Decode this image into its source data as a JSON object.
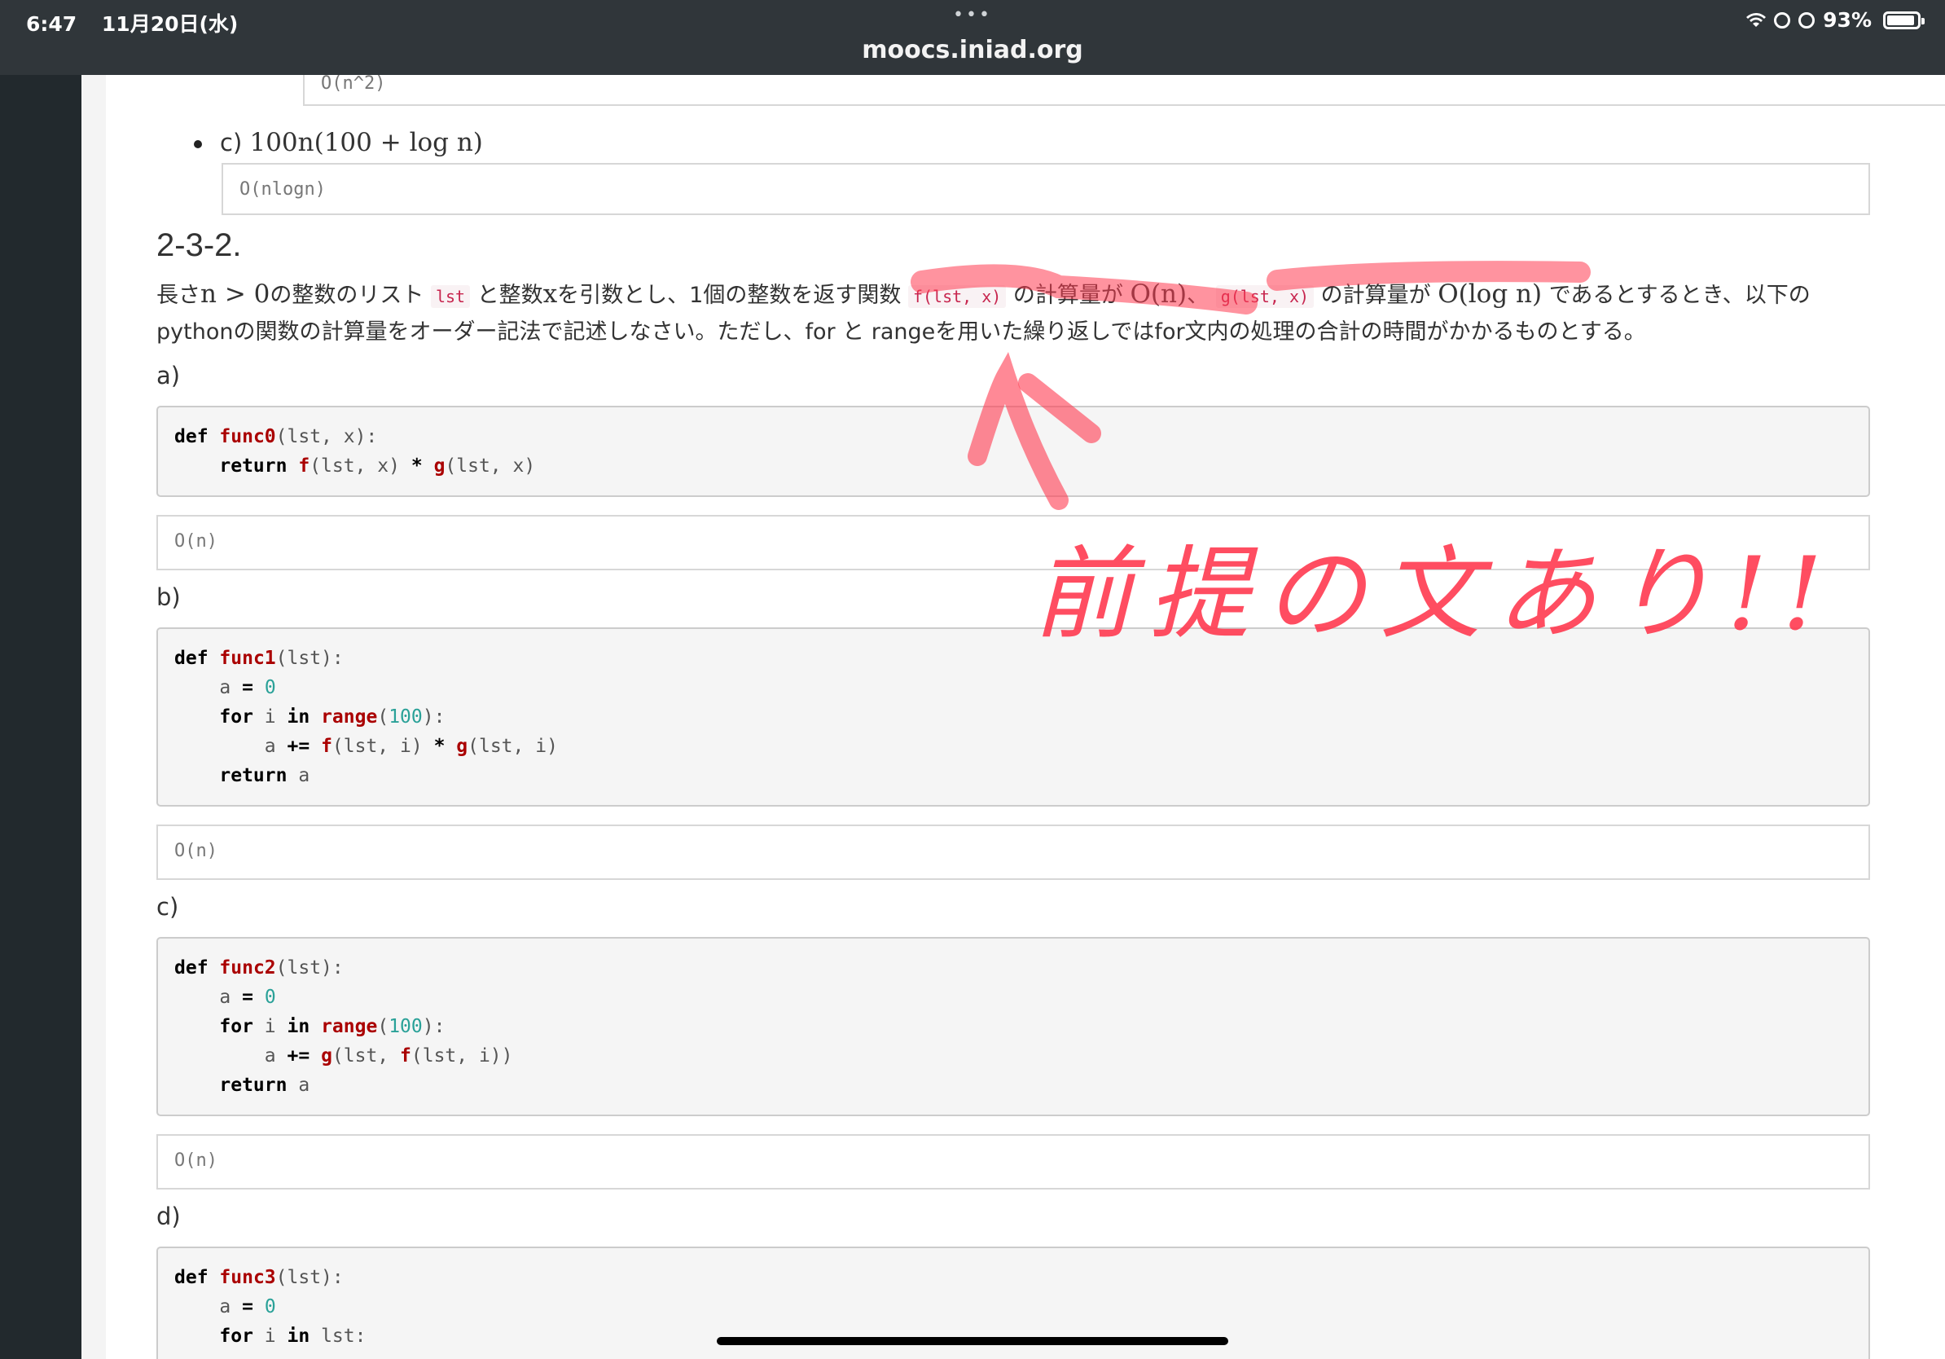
{
  "status_bar": {
    "time": "6:47",
    "date": "11月20日(水)",
    "battery": "93%",
    "battery_level": 0.93,
    "dots": "•••"
  },
  "url_bar": {
    "domain": "moocs.iniad.org"
  },
  "prev_answer": {
    "value": "O(n^2)"
  },
  "item_c": {
    "label": "c)",
    "math": "100n(100 + log n)",
    "answer": "O(nlogn)"
  },
  "section": {
    "title": "2-3-2.",
    "text_1": "長さ",
    "math_1": "n > 0",
    "text_2": "の整数のリスト",
    "code_lst": "lst",
    "text_3": "と整数",
    "math_x": "x",
    "text_4": "を引数とし、1個の整数を返す関数",
    "code_f": "f(lst, x)",
    "text_5": "の計算量が",
    "math_on": "O(n)",
    "text_6": "、",
    "code_g": "g(lst, x)",
    "text_7": "の計算量が",
    "math_ologn": "O(log n)",
    "text_8": "であるとするとき、以下のpythonの関数の計算量をオーダー記法で記述しなさい。ただし、for と rangeを用いた繰り返しではfor文内の処理の合計の時間がかかるものとする。"
  },
  "questions": [
    {
      "label": "a)",
      "answer": "O(n)",
      "code": {
        "l1_def": "def",
        "l1_name": "func0",
        "l1_rest": "(lst, x):",
        "l2_ret": "return",
        "l2_f": "f",
        "l2_a": "(lst, x)",
        "l2_op": "*",
        "l2_g": "g",
        "l2_b": "(lst, x)"
      }
    },
    {
      "label": "b)",
      "answer": "O(n)",
      "code": {
        "l1_def": "def",
        "l1_name": "func1",
        "l1_rest": "(lst):",
        "l2_a": "a",
        "l2_op": "=",
        "l2_n": "0",
        "l3_for": "for",
        "l3_i": "i",
        "l3_in": "in",
        "l3_range": "range",
        "l3_p1": "(",
        "l3_n": "100",
        "l3_p2": "):",
        "l4_a": "a",
        "l4_op": "+=",
        "l4_f": "f",
        "l4_x": "(lst, i)",
        "l4_mul": "*",
        "l4_g": "g",
        "l4_y": "(lst, i)",
        "l5_ret": "return",
        "l5_a": "a"
      }
    },
    {
      "label": "c)",
      "answer": "O(n)",
      "code": {
        "l1_def": "def",
        "l1_name": "func2",
        "l1_rest": "(lst):",
        "l2_a": "a",
        "l2_op": "=",
        "l2_n": "0",
        "l3_for": "for",
        "l3_i": "i",
        "l3_in": "in",
        "l3_range": "range",
        "l3_p1": "(",
        "l3_n": "100",
        "l3_p2": "):",
        "l4_a": "a",
        "l4_op": "+=",
        "l4_g": "g",
        "l4_x": "(lst, ",
        "l4_f": "f",
        "l4_y": "(lst, i))",
        "l5_ret": "return",
        "l5_a": "a"
      }
    },
    {
      "label": "d)",
      "code": {
        "l1_def": "def",
        "l1_name": "func3",
        "l1_rest": "(lst):",
        "l2_a": "a",
        "l2_op": "=",
        "l2_n": "0",
        "l3_for": "for",
        "l3_i": "i",
        "l3_in": "in",
        "l3_lst": "lst:"
      }
    }
  ],
  "annotation": {
    "text": "前提の文あり!!",
    "color": "#ff3a50"
  }
}
